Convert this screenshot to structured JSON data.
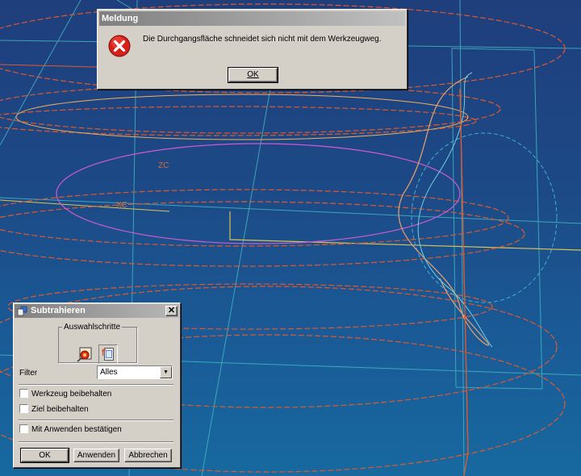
{
  "viewport": {
    "axis_labels": {
      "zc": "ZC",
      "xc": "XC"
    },
    "background_top": "#1f3e7c",
    "background_bottom": "#17699f"
  },
  "message_dialog": {
    "title": "Meldung",
    "icon": "error-icon",
    "text": "Die Durchgangsfläche schneidet sich nicht mit dem Werkzeugweg.",
    "ok_label": "OK"
  },
  "subtract_dialog": {
    "title": "Subtrahieren",
    "selection_steps_label": "Auswahlschritte",
    "step_icons": [
      "tool-body-select-icon",
      "target-body-select-icon"
    ],
    "filter_label": "Filter",
    "filter_value": "Alles",
    "keep_tool_label": "Werkzeug beibehalten",
    "keep_target_label": "Ziel beibehalten",
    "confirm_on_apply_label": "Mit Anwenden bestätigen",
    "ok_label": "OK",
    "apply_label": "Anwenden",
    "cancel_label": "Abbrechen"
  }
}
